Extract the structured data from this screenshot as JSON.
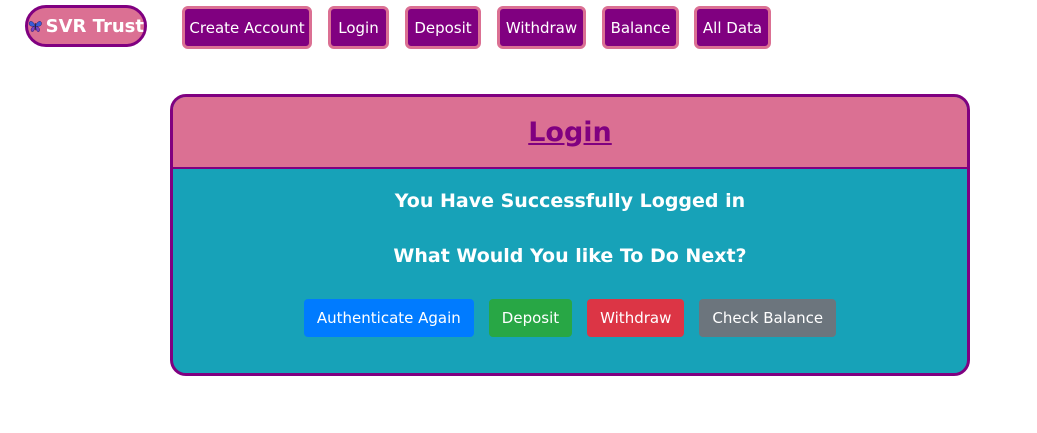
{
  "navbar": {
    "brand": "SVR Trust",
    "brand_icon": "butterfly-icon",
    "items": [
      "Create Account",
      "Login",
      "Deposit",
      "Withdraw",
      "Balance",
      "All Data"
    ]
  },
  "card": {
    "title": "Login",
    "message": "You Have Successfully Logged in",
    "prompt": "What Would You like To Do Next?",
    "actions": {
      "authenticate": "Authenticate Again",
      "deposit": "Deposit",
      "withdraw": "Withdraw",
      "balance": "Check Balance"
    }
  },
  "colors": {
    "primary_purple": "#800080",
    "pink": "#db7093",
    "teal": "#17a2b8",
    "blue": "#007bff",
    "green": "#28a745",
    "red": "#dc3545",
    "gray": "#6c757d"
  }
}
